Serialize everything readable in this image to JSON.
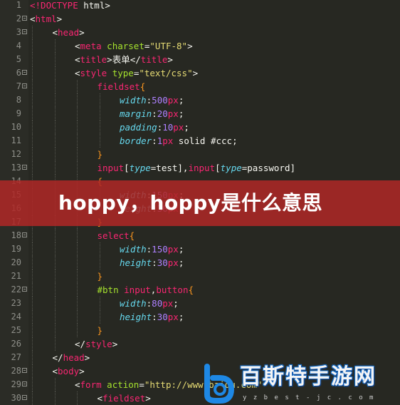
{
  "editor": {
    "lines": [
      {
        "n": "1",
        "fold": false,
        "indent": 0,
        "tokens": [
          {
            "t": "<!DOCTYPE",
            "c": "t"
          },
          {
            "t": " html>",
            "c": "p"
          }
        ]
      },
      {
        "n": "2",
        "fold": true,
        "indent": 0,
        "tokens": [
          {
            "t": "<",
            "c": "p"
          },
          {
            "t": "html",
            "c": "t"
          },
          {
            "t": ">",
            "c": "p"
          }
        ]
      },
      {
        "n": "3",
        "fold": true,
        "indent": 1,
        "tokens": [
          {
            "t": "<",
            "c": "p"
          },
          {
            "t": "head",
            "c": "t"
          },
          {
            "t": ">",
            "c": "p"
          }
        ]
      },
      {
        "n": "4",
        "fold": false,
        "indent": 2,
        "tokens": [
          {
            "t": "<",
            "c": "p"
          },
          {
            "t": "meta",
            "c": "t"
          },
          {
            "t": " charset",
            "c": "a"
          },
          {
            "t": "=",
            "c": "p"
          },
          {
            "t": "\"UTF-8\"",
            "c": "s"
          },
          {
            "t": ">",
            "c": "p"
          }
        ]
      },
      {
        "n": "5",
        "fold": false,
        "indent": 2,
        "tokens": [
          {
            "t": "<",
            "c": "p"
          },
          {
            "t": "title",
            "c": "t"
          },
          {
            "t": ">表单</",
            "c": "p"
          },
          {
            "t": "title",
            "c": "t"
          },
          {
            "t": ">",
            "c": "p"
          }
        ]
      },
      {
        "n": "6",
        "fold": true,
        "indent": 2,
        "tokens": [
          {
            "t": "<",
            "c": "p"
          },
          {
            "t": "style",
            "c": "t"
          },
          {
            "t": " type",
            "c": "a"
          },
          {
            "t": "=",
            "c": "p"
          },
          {
            "t": "\"text/css\"",
            "c": "s"
          },
          {
            "t": ">",
            "c": "p"
          }
        ]
      },
      {
        "n": "7",
        "fold": true,
        "indent": 3,
        "tokens": [
          {
            "t": "fieldset",
            "c": "t"
          },
          {
            "t": "{",
            "c": "c"
          }
        ]
      },
      {
        "n": "8",
        "fold": false,
        "indent": 4,
        "tokens": [
          {
            "t": "width",
            "c": "k"
          },
          {
            "t": ":",
            "c": "p"
          },
          {
            "t": "500",
            "c": "n"
          },
          {
            "t": "px",
            "c": "t"
          },
          {
            "t": ";",
            "c": "p"
          }
        ]
      },
      {
        "n": "9",
        "fold": false,
        "indent": 4,
        "tokens": [
          {
            "t": "margin",
            "c": "k"
          },
          {
            "t": ":",
            "c": "p"
          },
          {
            "t": "20",
            "c": "n"
          },
          {
            "t": "px",
            "c": "t"
          },
          {
            "t": ";",
            "c": "p"
          }
        ]
      },
      {
        "n": "10",
        "fold": false,
        "indent": 4,
        "tokens": [
          {
            "t": "padding",
            "c": "k"
          },
          {
            "t": ":",
            "c": "p"
          },
          {
            "t": "10",
            "c": "n"
          },
          {
            "t": "px",
            "c": "t"
          },
          {
            "t": ";",
            "c": "p"
          }
        ]
      },
      {
        "n": "11",
        "fold": false,
        "indent": 4,
        "tokens": [
          {
            "t": "border",
            "c": "k"
          },
          {
            "t": ":",
            "c": "p"
          },
          {
            "t": "1",
            "c": "n"
          },
          {
            "t": "px",
            "c": "t"
          },
          {
            "t": " solid #ccc;",
            "c": "p"
          }
        ]
      },
      {
        "n": "12",
        "fold": false,
        "indent": 3,
        "tokens": [
          {
            "t": "}",
            "c": "c"
          }
        ]
      },
      {
        "n": "13",
        "fold": true,
        "indent": 3,
        "tokens": [
          {
            "t": "input",
            "c": "t"
          },
          {
            "t": "[",
            "c": "p"
          },
          {
            "t": "type",
            "c": "k"
          },
          {
            "t": "=test],",
            "c": "p"
          },
          {
            "t": "input",
            "c": "t"
          },
          {
            "t": "[",
            "c": "p"
          },
          {
            "t": "type",
            "c": "k"
          },
          {
            "t": "=password]",
            "c": "p"
          }
        ]
      },
      {
        "n": "14",
        "fold": false,
        "indent": 3,
        "tokens": [
          {
            "t": "{",
            "c": "c"
          }
        ]
      },
      {
        "n": "15",
        "fold": false,
        "indent": 4,
        "tokens": [
          {
            "t": "width",
            "c": "k"
          },
          {
            "t": ":",
            "c": "p"
          },
          {
            "t": "150",
            "c": "n"
          },
          {
            "t": "px",
            "c": "t"
          },
          {
            "t": ";",
            "c": "p"
          }
        ]
      },
      {
        "n": "16",
        "fold": false,
        "indent": 4,
        "tokens": [
          {
            "t": "height",
            "c": "k"
          },
          {
            "t": ":",
            "c": "p"
          },
          {
            "t": "30",
            "c": "n"
          },
          {
            "t": "px",
            "c": "t"
          },
          {
            "t": ";",
            "c": "p"
          }
        ]
      },
      {
        "n": "17",
        "fold": false,
        "indent": 3,
        "tokens": [
          {
            "t": "}",
            "c": "c"
          }
        ]
      },
      {
        "n": "18",
        "fold": true,
        "indent": 3,
        "tokens": [
          {
            "t": "select",
            "c": "t"
          },
          {
            "t": "{",
            "c": "c"
          }
        ]
      },
      {
        "n": "19",
        "fold": false,
        "indent": 4,
        "tokens": [
          {
            "t": "width",
            "c": "k"
          },
          {
            "t": ":",
            "c": "p"
          },
          {
            "t": "150",
            "c": "n"
          },
          {
            "t": "px",
            "c": "t"
          },
          {
            "t": ";",
            "c": "p"
          }
        ]
      },
      {
        "n": "20",
        "fold": false,
        "indent": 4,
        "tokens": [
          {
            "t": "height",
            "c": "k"
          },
          {
            "t": ":",
            "c": "p"
          },
          {
            "t": "30",
            "c": "n"
          },
          {
            "t": "px",
            "c": "t"
          },
          {
            "t": ";",
            "c": "p"
          }
        ]
      },
      {
        "n": "21",
        "fold": false,
        "indent": 3,
        "tokens": [
          {
            "t": "}",
            "c": "c"
          }
        ]
      },
      {
        "n": "22",
        "fold": true,
        "indent": 3,
        "tokens": [
          {
            "t": "#btn ",
            "c": "a"
          },
          {
            "t": "input",
            "c": "t"
          },
          {
            "t": ",",
            "c": "p"
          },
          {
            "t": "button",
            "c": "t"
          },
          {
            "t": "{",
            "c": "c"
          }
        ]
      },
      {
        "n": "23",
        "fold": false,
        "indent": 4,
        "tokens": [
          {
            "t": "width",
            "c": "k"
          },
          {
            "t": ":",
            "c": "p"
          },
          {
            "t": "80",
            "c": "n"
          },
          {
            "t": "px",
            "c": "t"
          },
          {
            "t": ";",
            "c": "p"
          }
        ]
      },
      {
        "n": "24",
        "fold": false,
        "indent": 4,
        "tokens": [
          {
            "t": "height",
            "c": "k"
          },
          {
            "t": ":",
            "c": "p"
          },
          {
            "t": "30",
            "c": "n"
          },
          {
            "t": "px",
            "c": "t"
          },
          {
            "t": ";",
            "c": "p"
          }
        ]
      },
      {
        "n": "25",
        "fold": false,
        "indent": 3,
        "tokens": [
          {
            "t": "}",
            "c": "c"
          }
        ]
      },
      {
        "n": "26",
        "fold": false,
        "indent": 2,
        "tokens": [
          {
            "t": "</",
            "c": "p"
          },
          {
            "t": "style",
            "c": "t"
          },
          {
            "t": ">",
            "c": "p"
          }
        ]
      },
      {
        "n": "27",
        "fold": false,
        "indent": 1,
        "tokens": [
          {
            "t": "</",
            "c": "p"
          },
          {
            "t": "head",
            "c": "t"
          },
          {
            "t": ">",
            "c": "p"
          }
        ]
      },
      {
        "n": "28",
        "fold": true,
        "indent": 1,
        "tokens": [
          {
            "t": "<",
            "c": "p"
          },
          {
            "t": "body",
            "c": "t"
          },
          {
            "t": ">",
            "c": "p"
          }
        ]
      },
      {
        "n": "29",
        "fold": true,
        "indent": 2,
        "tokens": [
          {
            "t": "<",
            "c": "p"
          },
          {
            "t": "form",
            "c": "t"
          },
          {
            "t": " action",
            "c": "a"
          },
          {
            "t": "=",
            "c": "p"
          },
          {
            "t": "\"http://www.baidu.com\"",
            "c": "s"
          }
        ]
      },
      {
        "n": "30",
        "fold": true,
        "indent": 3,
        "tokens": [
          {
            "t": "<",
            "c": "p"
          },
          {
            "t": "fieldset",
            "c": "t"
          },
          {
            "t": ">",
            "c": "p"
          }
        ]
      }
    ]
  },
  "banner": {
    "title": "hoppy，hoppy是什么意思"
  },
  "watermark": {
    "name": "百斯特手游网",
    "url": "y z b e s t - j c . c o m"
  },
  "colors": {
    "background": "#272822",
    "tag": "#f92672",
    "attribute": "#a6e22e",
    "string": "#e6db74",
    "number": "#ae81ff",
    "property": "#66d9ef",
    "brace": "#fd971f",
    "banner": "#af2826"
  }
}
